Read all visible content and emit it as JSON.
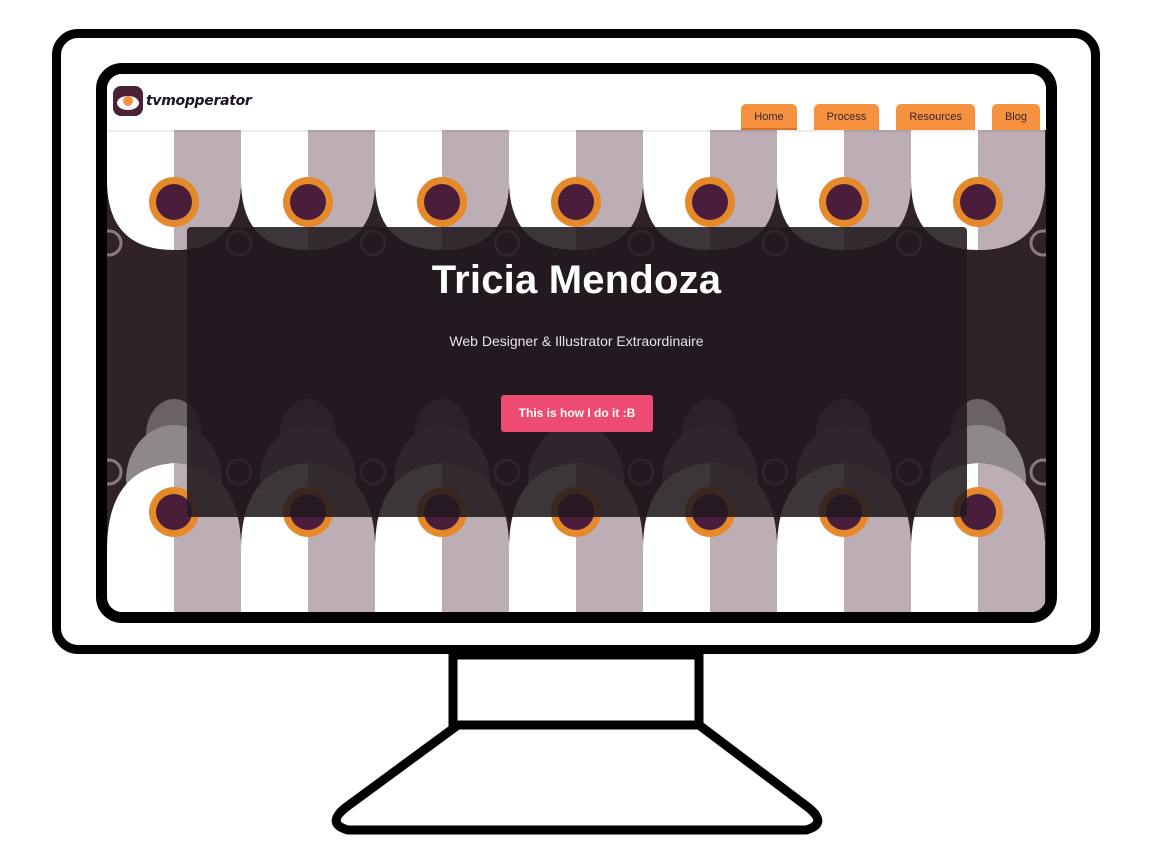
{
  "site": {
    "logo_text": "tvmopperator",
    "nav": [
      {
        "label": "Home",
        "active": true
      },
      {
        "label": "Process"
      },
      {
        "label": "Resources"
      },
      {
        "label": "Blog"
      }
    ]
  },
  "hero": {
    "title": "Tricia Mendoza",
    "subtitle": "Web Designer & Illustrator Extraordinaire",
    "cta_label": "This is how I do it :B"
  },
  "colors": {
    "nav_tab": "#f6913f",
    "cta": "#ee4b73",
    "egg_yolk_ring": "#e5892a",
    "egg_center": "#4a1e3b",
    "pattern_mauve": "#bdaeb6",
    "overlay": "#21191f"
  },
  "icons": [
    "fried-egg-logo-icon"
  ]
}
